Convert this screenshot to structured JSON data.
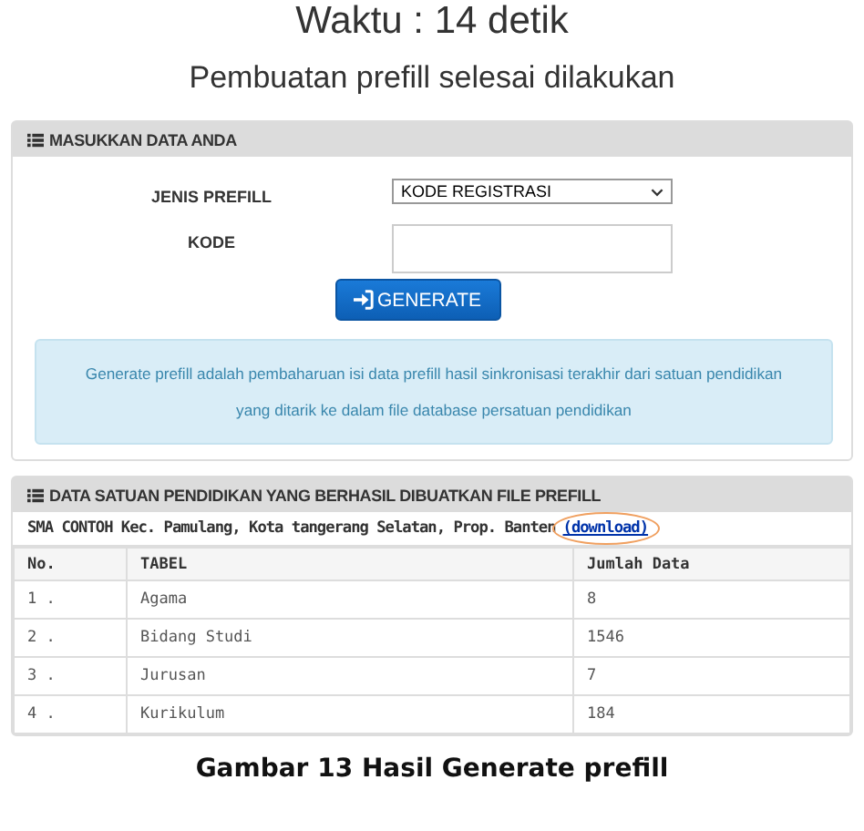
{
  "title": "Waktu : 14 detik",
  "subtitle": "Pembuatan prefill selesai dilakukan",
  "form_panel": {
    "heading": "MASUKKAN DATA ANDA",
    "fields": [
      {
        "kind": "select",
        "label": "JENIS PREFILL",
        "value": "KODE REGISTRASI"
      },
      {
        "kind": "text",
        "label": "KODE"
      }
    ],
    "button": "GENERATE",
    "info": "Generate prefill adalah pembaharuan isi data prefill hasil sinkronisasi terakhir dari satuan pendidikan yang ditarik ke dalam file database persatuan pendidikan"
  },
  "result_panel": {
    "heading": "DATA SATUAN PENDIDIKAN YANG BERHASIL DIBUATKAN FILE PREFILL",
    "school": "SMA CONTOH Kec. Pamulang, Kota tangerang Selatan, Prop. Banten",
    "link": "(download)",
    "columns": [
      "No.",
      "TABEL",
      "Jumlah Data"
    ],
    "rows": [
      [
        "1 .",
        "Agama",
        "8"
      ],
      [
        "2 .",
        "Bidang Studi",
        "1546"
      ],
      [
        "3 .",
        "Jurusan",
        "7"
      ],
      [
        "4 .",
        "Kurikulum",
        "184"
      ]
    ]
  },
  "caption": "Gambar 13 Hasil Generate prefill"
}
